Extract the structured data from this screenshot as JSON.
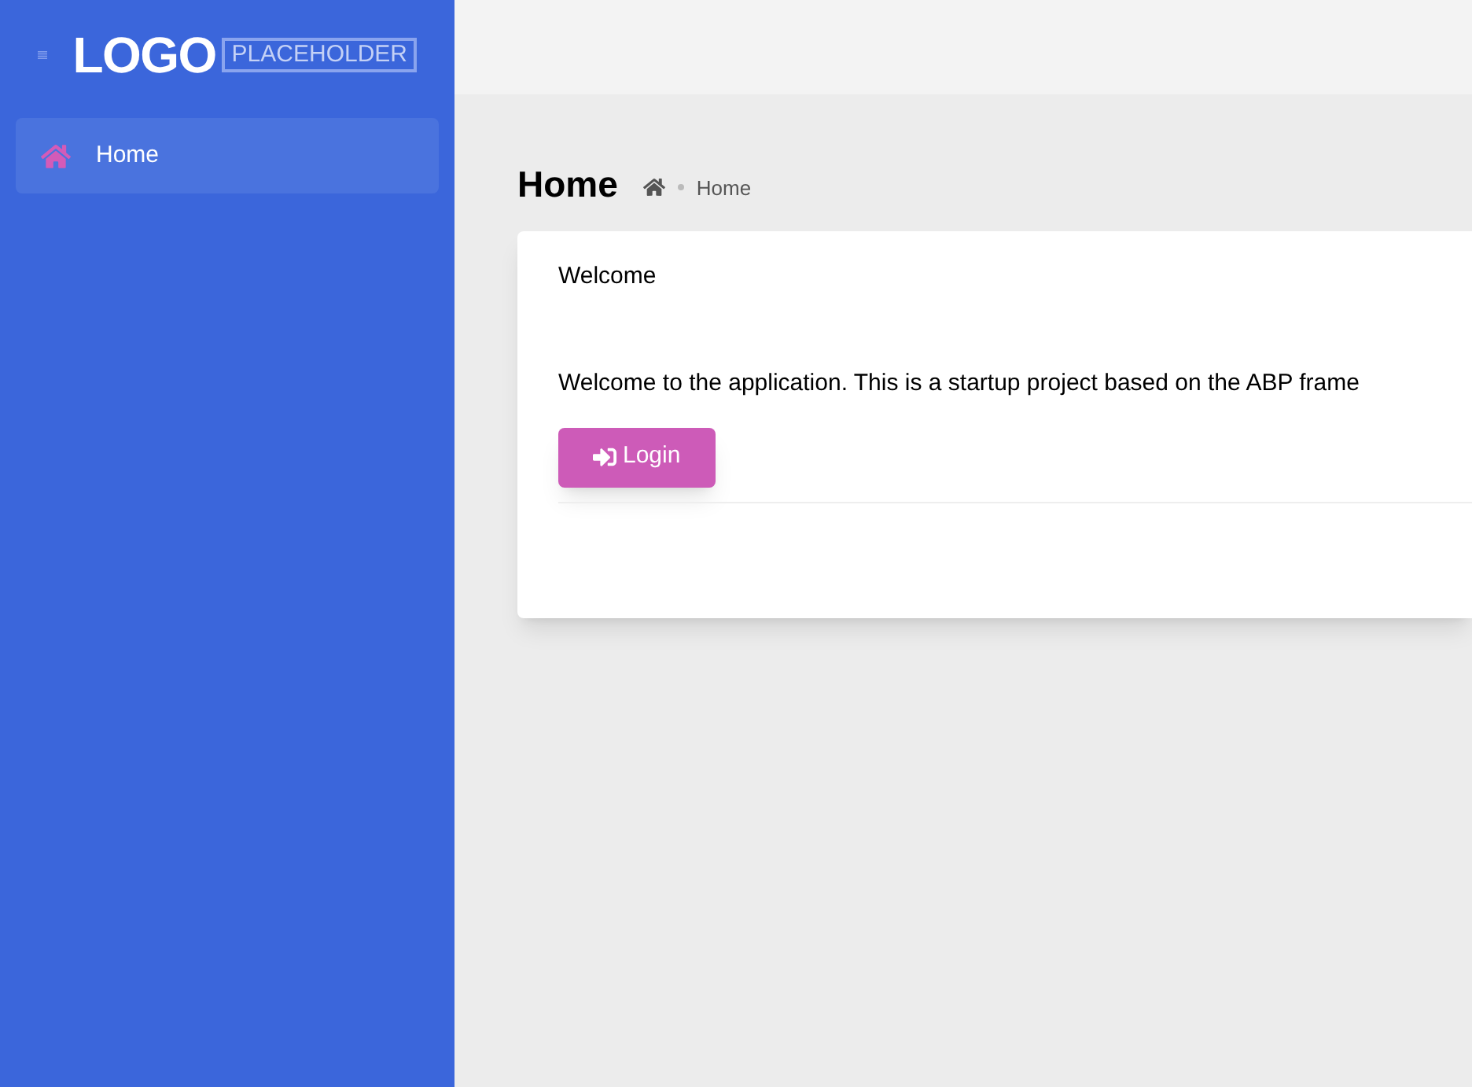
{
  "sidebar": {
    "logo": {
      "word": "LOGO",
      "tag": "PLACEHOLDER"
    },
    "items": [
      {
        "label": "Home",
        "selected": true
      }
    ]
  },
  "page": {
    "title": "Home",
    "breadcrumb": [
      "Home"
    ]
  },
  "card": {
    "title": "Welcome",
    "message": "Welcome to the application. This is a startup project based on the ABP frame",
    "button": "Login"
  }
}
